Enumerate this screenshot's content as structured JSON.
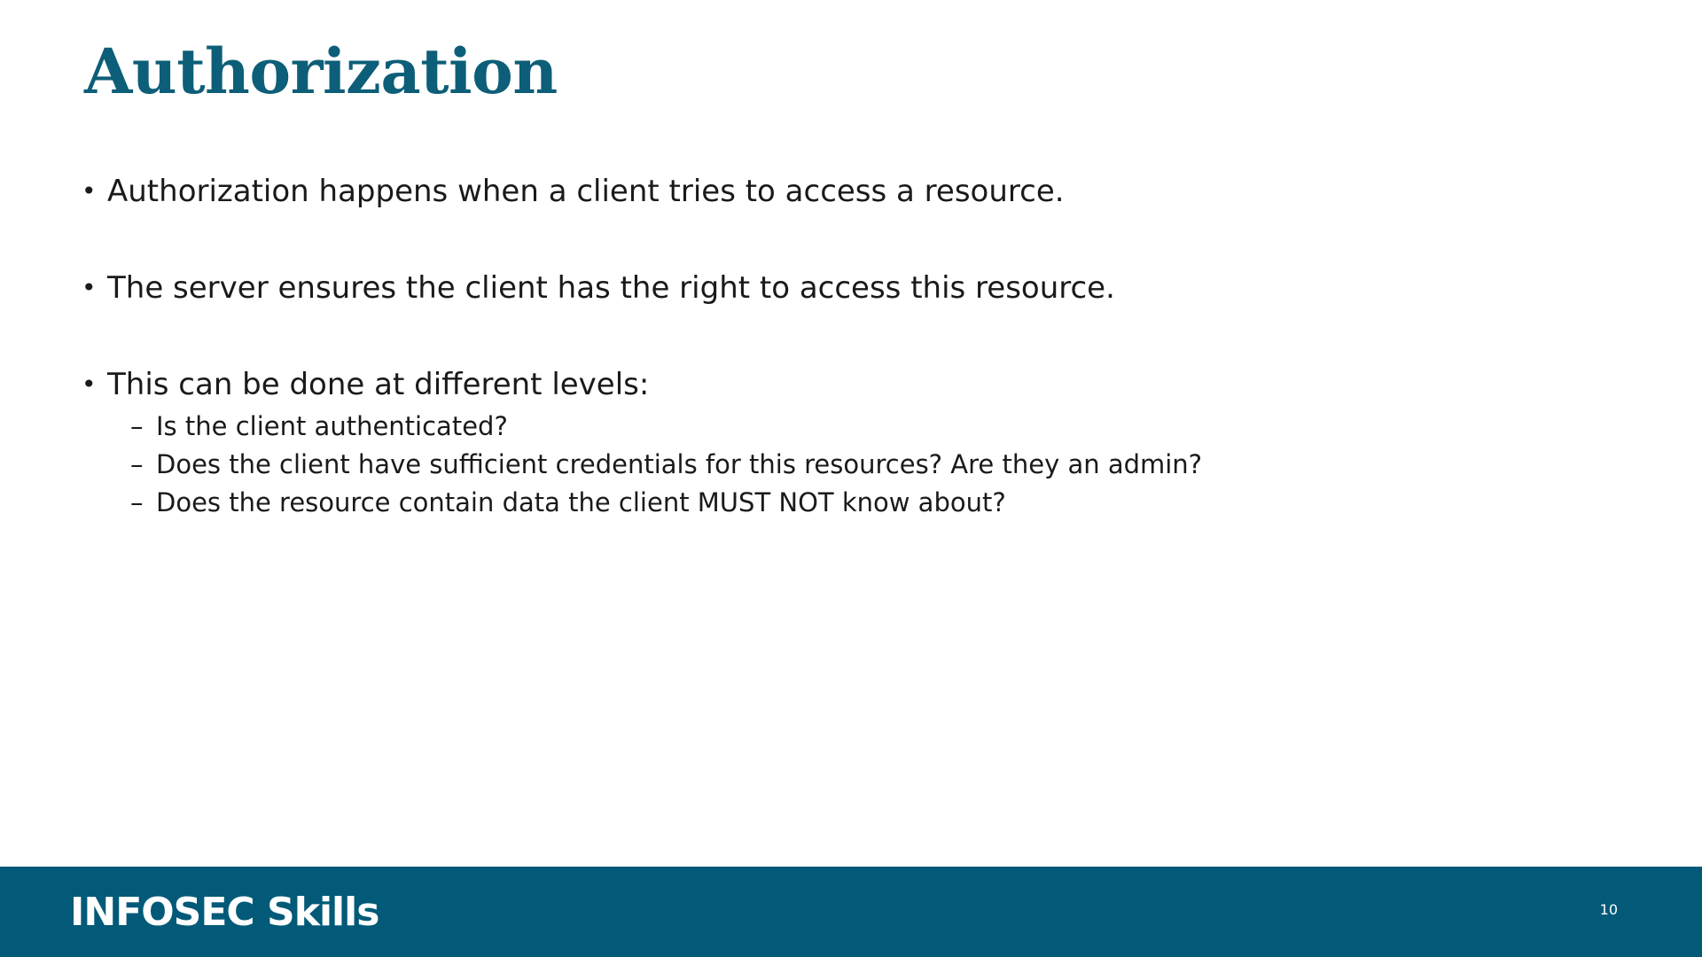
{
  "slide": {
    "title": "Authorization",
    "bullet_marker": "•",
    "sub_marker": "–",
    "bullets": [
      {
        "text": "Authorization happens when a client tries to access a resource."
      },
      {
        "text": "The server ensures the client has the right to access this resource."
      },
      {
        "text": "This can be done at different levels:",
        "subbullets": [
          "Is the client authenticated?",
          "Does the client have sufficient credentials for this resources? Are they an admin?",
          "Does the resource contain data the client MUST NOT know about?"
        ]
      }
    ]
  },
  "footer": {
    "logo_text": "INFOSEC Skills",
    "page_number": "10"
  },
  "colors": {
    "title": "#0d5e78",
    "footer_background": "#025a78",
    "body_text": "#1a1a1a"
  }
}
